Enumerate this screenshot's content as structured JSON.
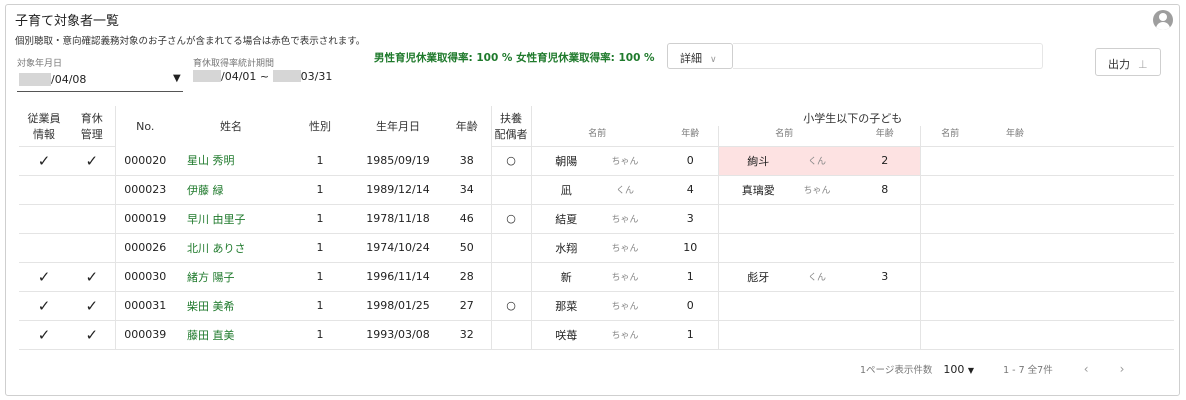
{
  "header": {
    "title": "子育て対象者一覧",
    "note": "個別聴取・意向確認義務対象のお子さんが含まれてる場合は赤色で表示されます。"
  },
  "filters": {
    "month_label": "対象年月日",
    "month_value": "/04/08",
    "period_label": "育休取得率統計期間",
    "period_start": "/04/01 ~",
    "period_end": "03/31"
  },
  "rates": {
    "text": "男性育児休業取得率: 100 % 女性育児休業取得率: 100 %"
  },
  "buttons": {
    "detail": "詳細",
    "export": "出力"
  },
  "table": {
    "headers": {
      "employee_info": [
        "従業員",
        "情報"
      ],
      "childcare_mgmt": [
        "育休",
        "管理"
      ],
      "no": "No.",
      "name": "姓名",
      "gender": "性別",
      "birthday": "生年月日",
      "age": "年齢",
      "dependent_spouse": [
        "扶養",
        "配偶者"
      ],
      "children_group": "小学生以下の子ども",
      "child_name": "名前",
      "child_age": "年齢"
    },
    "rows": [
      {
        "info": "✓",
        "mgmt": "✓",
        "no": "000020",
        "name": "星山 秀明",
        "gender": "1",
        "birthday": "1985/09/19",
        "age": "38",
        "spouse": "○",
        "c1_name": "朝陽",
        "c1_hon": "ちゃん",
        "c1_age": "0",
        "c2_name": "絢斗",
        "c2_hon": "くん",
        "c2_age": "2"
      },
      {
        "info": "",
        "mgmt": "",
        "no": "000023",
        "name": "伊藤 緑",
        "gender": "1",
        "birthday": "1989/12/14",
        "age": "34",
        "spouse": "",
        "c1_name": "凪",
        "c1_hon": "くん",
        "c1_age": "4",
        "c2_name": "真璃愛",
        "c2_hon": "ちゃん",
        "c2_age": "8"
      },
      {
        "info": "",
        "mgmt": "",
        "no": "000019",
        "name": "早川 由里子",
        "gender": "1",
        "birthday": "1978/11/18",
        "age": "46",
        "spouse": "○",
        "c1_name": "結夏",
        "c1_hon": "ちゃん",
        "c1_age": "3",
        "c2_name": "",
        "c2_hon": "",
        "c2_age": ""
      },
      {
        "info": "",
        "mgmt": "",
        "no": "000026",
        "name": "北川 ありさ",
        "gender": "1",
        "birthday": "1974/10/24",
        "age": "50",
        "spouse": "",
        "c1_name": "水翔",
        "c1_hon": "ちゃん",
        "c1_age": "10",
        "c2_name": "",
        "c2_hon": "",
        "c2_age": ""
      },
      {
        "info": "✓",
        "mgmt": "✓",
        "no": "000030",
        "name": "緒方 陽子",
        "gender": "1",
        "birthday": "1996/11/14",
        "age": "28",
        "spouse": "",
        "c1_name": "新",
        "c1_hon": "ちゃん",
        "c1_age": "1",
        "c2_name": "彪牙",
        "c2_hon": "くん",
        "c2_age": "3"
      },
      {
        "info": "✓",
        "mgmt": "✓",
        "no": "000031",
        "name": "柴田 美希",
        "gender": "1",
        "birthday": "1998/01/25",
        "age": "27",
        "spouse": "○",
        "c1_name": "那菜",
        "c1_hon": "ちゃん",
        "c1_age": "0",
        "c2_name": "",
        "c2_hon": "",
        "c2_age": ""
      },
      {
        "info": "✓",
        "mgmt": "✓",
        "no": "000039",
        "name": "藤田 直美",
        "gender": "1",
        "birthday": "1993/03/08",
        "age": "32",
        "spouse": "",
        "c1_name": "咲苺",
        "c1_hon": "ちゃん",
        "c1_age": "1",
        "c2_name": "",
        "c2_hon": "",
        "c2_age": ""
      }
    ]
  },
  "pager": {
    "per_page_label": "1ページ表示件数",
    "per_page_value": "100",
    "count": "1 - 7  全7件",
    "prev": "‹",
    "next": "›"
  },
  "colors": {
    "accent_green": "#1f7a2c",
    "highlight_red": "#fde2e2"
  },
  "icons": {
    "avatar": "user-avatar-icon",
    "dropdown": "caret-down-icon",
    "chevron": "chevron-down-icon",
    "download": "download-icon"
  }
}
